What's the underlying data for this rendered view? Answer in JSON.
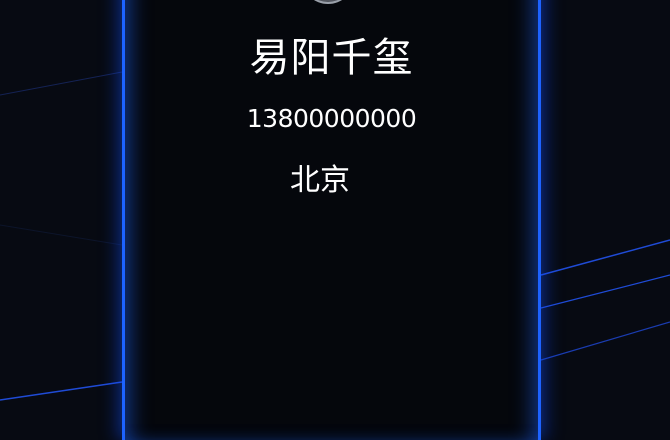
{
  "profile": {
    "name": "易阳千玺",
    "phone": "13800000000",
    "city": "北京"
  },
  "colors": {
    "background": "#070a12",
    "card": "#05070c",
    "accent": "#1d63ff",
    "text": "#ffffff"
  },
  "icons": {
    "avatar": "user-avatar-image"
  }
}
